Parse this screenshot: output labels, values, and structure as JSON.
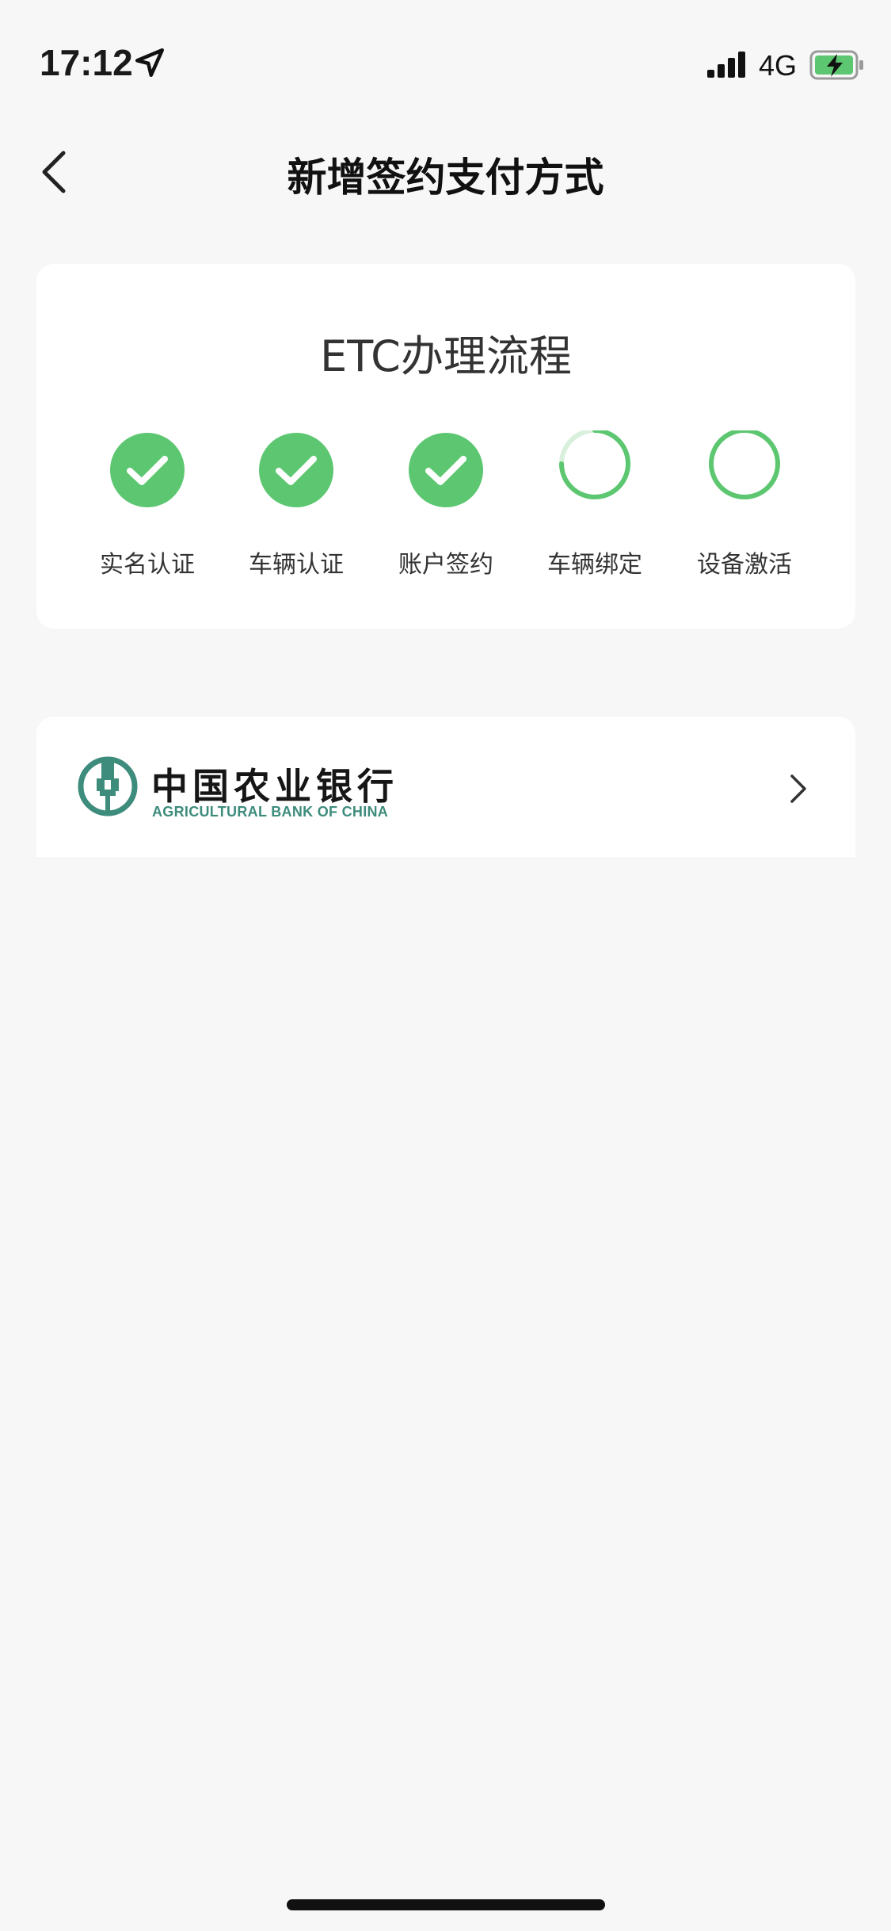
{
  "status_bar": {
    "time": "17:12",
    "network": "4G"
  },
  "nav": {
    "title": "新增签约支付方式"
  },
  "process": {
    "title": "ETC办理流程",
    "steps": [
      {
        "label": "实名认证",
        "status": "done"
      },
      {
        "label": "车辆认证",
        "status": "done"
      },
      {
        "label": "账户签约",
        "status": "done"
      },
      {
        "label": "车辆绑定",
        "status": "in-progress"
      },
      {
        "label": "设备激活",
        "status": "pending"
      }
    ]
  },
  "bank": {
    "name_cn": "中国农业银行",
    "name_en": "AGRICULTURAL BANK OF CHINA"
  },
  "colors": {
    "accent_green": "#5cc770",
    "bank_green": "#3d8c7c",
    "background": "#f7f7f7"
  }
}
